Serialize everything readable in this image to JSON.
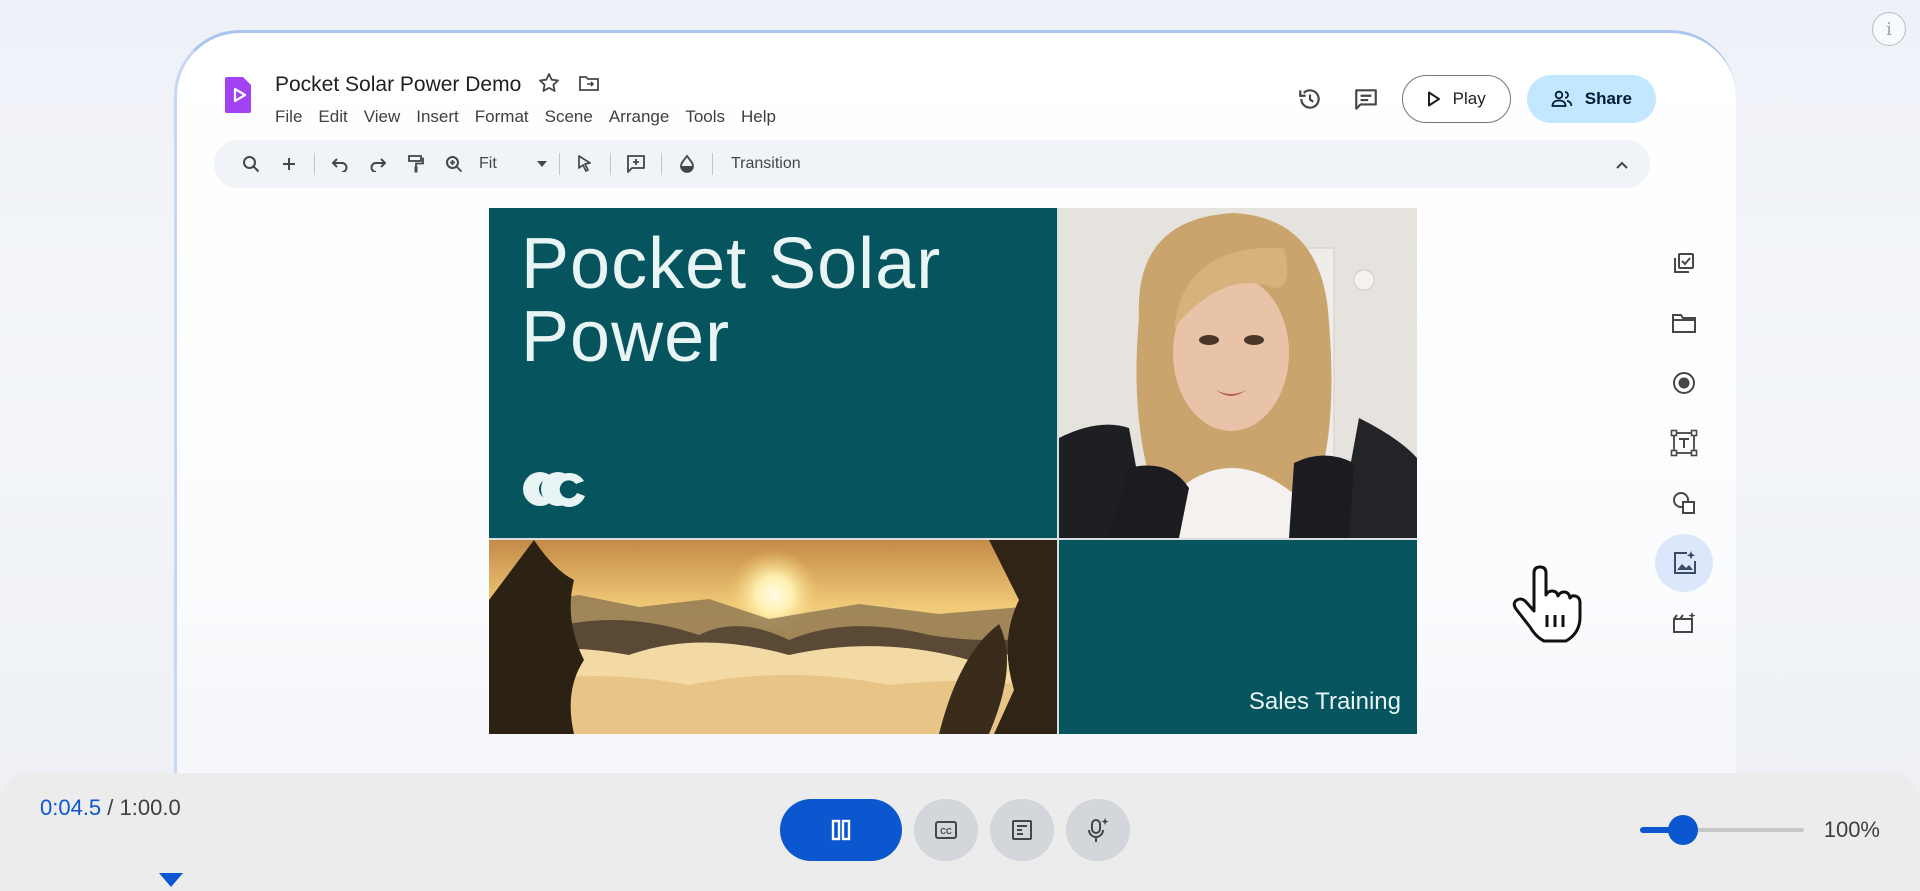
{
  "app": {
    "title": "Pocket Solar Power Demo",
    "menu": [
      "File",
      "Edit",
      "View",
      "Insert",
      "Format",
      "Scene",
      "Arrange",
      "Tools",
      "Help"
    ],
    "play_label": "Play",
    "share_label": "Share"
  },
  "toolbar": {
    "zoom_select": "Fit",
    "transition_label": "Transition"
  },
  "slide": {
    "title": "Pocket Solar Power",
    "subtitle": "Sales Training"
  },
  "player": {
    "current_time": "0:04.5",
    "total_time": " / 1:00.0",
    "zoom_label": "100%",
    "volume_fraction": 0.24
  },
  "colors": {
    "accent": "#0b57d0",
    "slide_teal": "#05545e",
    "share_bg": "#c2e7ff",
    "logo_purple": "#a142f4"
  },
  "icons": {
    "rail": [
      "add-to-scene-icon",
      "folder-icon",
      "record-icon",
      "text-box-icon",
      "shapes-icon",
      "generate-image-icon",
      "add-media-icon"
    ]
  }
}
